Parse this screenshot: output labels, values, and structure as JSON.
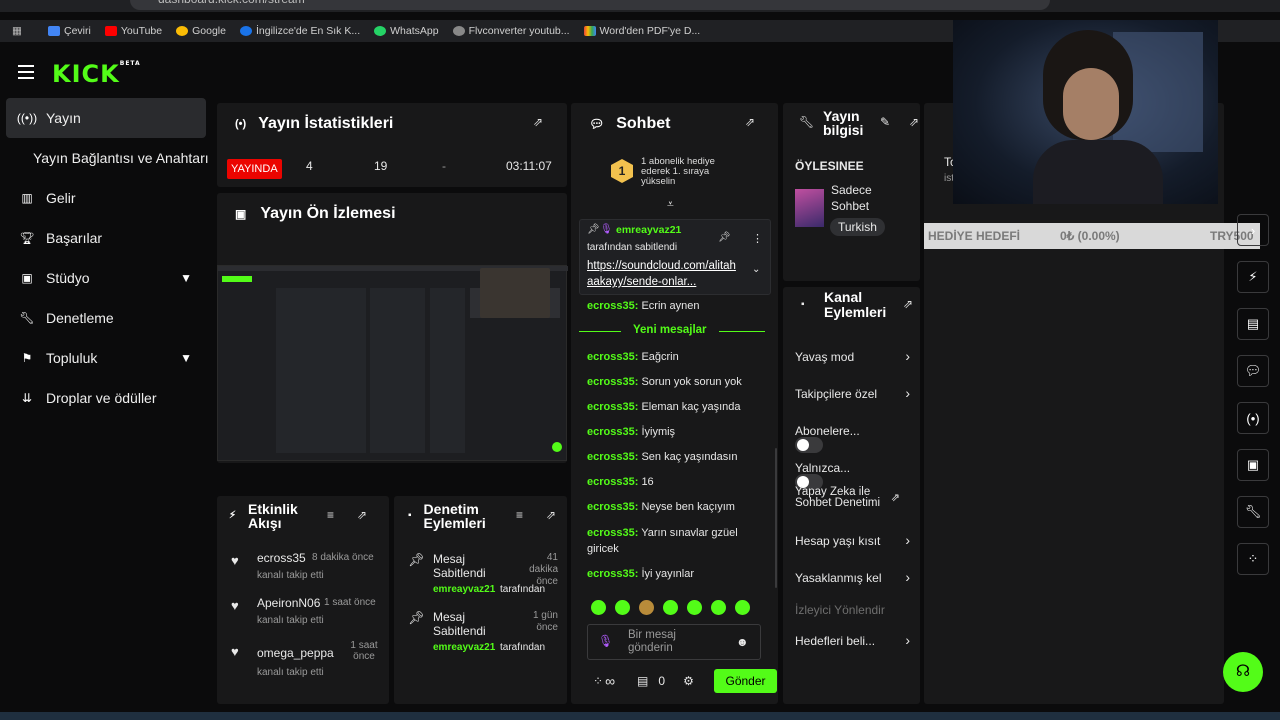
{
  "browser": {
    "url": "dashboard.kick.com/stream",
    "bookmarks": [
      "Çeviri",
      "YouTube",
      "Google",
      "İngilizce'de En Sık K...",
      "WhatsApp",
      "Flvconverter youtub...",
      "Word'den PDF'ye D..."
    ]
  },
  "brand": {
    "logo": "KICK",
    "badge": "BETA",
    "accent": "#53fc18"
  },
  "nav": {
    "items": [
      "Yayın",
      "Yayın Bağlantısı ve Anahtarı",
      "Gelir",
      "Başarılar",
      "Stüdyo",
      "Denetleme",
      "Topluluk",
      "Droplar ve ödüller"
    ]
  },
  "stats": {
    "title": "Yayın İstatistikleri",
    "live": "YAYINDA",
    "viewers": "4",
    "followers": "19",
    "dash": "-",
    "uptime": "03:11:07"
  },
  "preview": {
    "title": "Yayın Ön İzlemesi"
  },
  "activity": {
    "title": "Etkinlik Akışı",
    "items": [
      {
        "user": "ecross35",
        "time": "8 dakika önce",
        "action": "kanalı takip etti"
      },
      {
        "user": "ApeironN06",
        "time": "1 saat önce",
        "action": "kanalı takip etti"
      },
      {
        "user": "omega_peppa",
        "time": "1 saat önce",
        "action": "kanalı takip etti"
      }
    ]
  },
  "mod": {
    "title": "Denetim Eylemleri",
    "items": [
      {
        "action": "Mesaj Sabitlendi",
        "time": "41 dakika önce",
        "user": "emreayvaz21",
        "suffix": "tarafından"
      },
      {
        "action": "Mesaj Sabitlendi",
        "time": "1 gün önce",
        "user": "emreayvaz21",
        "suffix": "tarafından"
      }
    ]
  },
  "chat": {
    "title": "Sohbet",
    "goal_number": "1",
    "goal_text": "1 abonelik hediye ederek 1. sıraya yükselin",
    "pinned": {
      "user": "emreayvaz21",
      "by": "tarafından sabitlendi",
      "link": "https://soundcloud.com/alitahaakayy/sende-onlar..."
    },
    "first": {
      "user": "ecross35:",
      "text": "Ecrin aynen"
    },
    "divider": "Yeni mesajlar",
    "messages": [
      {
        "user": "ecross35:",
        "text": "Eağcrin"
      },
      {
        "user": "ecross35:",
        "text": "Sorun yok sorun yok"
      },
      {
        "user": "ecross35:",
        "text": "Eleman kaç yaşında"
      },
      {
        "user": "ecross35:",
        "text": "İyiymiş"
      },
      {
        "user": "ecross35:",
        "text": "Sen kaç yaşındasın"
      },
      {
        "user": "ecross35:",
        "text": "16"
      },
      {
        "user": "ecross35:",
        "text": "Neyse ben kaçıyım"
      },
      {
        "user": "ecross35:",
        "text": "Yarın sınavlar gzüel giricek"
      },
      {
        "user": "ecross35:",
        "text": "İyi yayınlar"
      }
    ],
    "placeholder": "Bir mesaj gönderin",
    "send": "Gönder",
    "infinity": "∞",
    "count": "0"
  },
  "info": {
    "title": "Yayın bilgisi",
    "stream_title": "ÖYLESINEE",
    "category": "Sadece Sohbet",
    "language": "Turkish"
  },
  "actions": {
    "title": "Kanal Eylemleri",
    "items": [
      "Yavaş mod",
      "Takipçilere özel",
      "Abonelere...",
      "Yalnızca...",
      "Yapay Zeka ile Sohbet Denetimi",
      "Hesap yaşı kısıt",
      "Yasaklanmış kel",
      "İzleyici Yönlendir",
      "Hedefleri beli..."
    ]
  },
  "gift": {
    "label": "HEDİYE HEDEFİ",
    "value": "0₺ (0.00%)",
    "target": "TRY500",
    "progress": 0
  },
  "extra": {
    "t1": "Tc",
    "t2": "ist"
  }
}
